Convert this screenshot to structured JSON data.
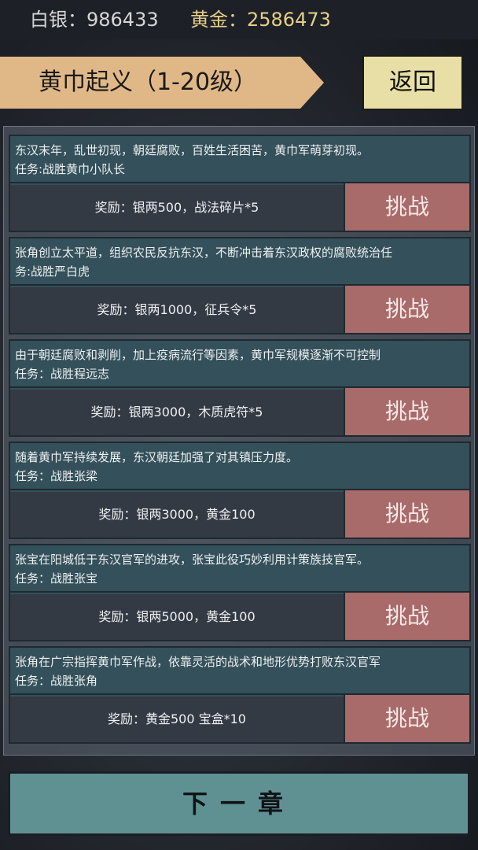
{
  "currency": {
    "silver_label": "白银：",
    "silver_value": "986433",
    "gold_label": "黄金：",
    "gold_value": "2586473"
  },
  "chapter": {
    "title": "黄巾起义（1-20级）",
    "back_label": "返回"
  },
  "quests": [
    {
      "line1": "东汉末年，乱世初现，朝廷腐败，百姓生活困苦，黄巾军萌芽初现。",
      "line2": "任务:战胜黄巾小队长",
      "reward": "奖励：银两500，战法碎片*5",
      "button": "挑战"
    },
    {
      "line1": "张角创立太平道，组织农民反抗东汉，不断冲击着东汉政权的腐败统治任",
      "line2": "务:战胜严白虎",
      "reward": "奖励：银两1000，征兵令*5",
      "button": "挑战"
    },
    {
      "line1": "由于朝廷腐败和剥削，加上疫病流行等因素，黄巾军规模逐渐不可控制",
      "line2": "任务：战胜程远志",
      "reward": "奖励：银两3000，木质虎符*5",
      "button": "挑战"
    },
    {
      "line1": "随着黄巾军持续发展，东汉朝廷加强了对其镇压力度。",
      "line2": "任务：战胜张梁",
      "reward": "奖励：银两3000，黄金100",
      "button": "挑战"
    },
    {
      "line1": "张宝在阳城低于东汉官军的进攻，张宝此役巧妙利用计策族技官军。",
      "line2": "任务：战胜张宝",
      "reward": "奖励：银两5000，黄金100",
      "button": "挑战"
    },
    {
      "line1": "张角在广宗指挥黄巾军作战，依靠灵活的战术和地形优势打败东汉官军",
      "line2": "任务：战胜张角",
      "reward": "奖励：黄金500 宝盒*10",
      "button": "挑战"
    }
  ],
  "footer": {
    "next_label": "下一章"
  },
  "colors": {
    "gold_text": "#e6cf88",
    "banner": "#e0b888",
    "back_button": "#e8dfa6",
    "quest_desc_bg": "#34505a",
    "reward_bg": "#343a44",
    "challenge_button": "#a96a6a",
    "next_button": "#5f9193"
  }
}
